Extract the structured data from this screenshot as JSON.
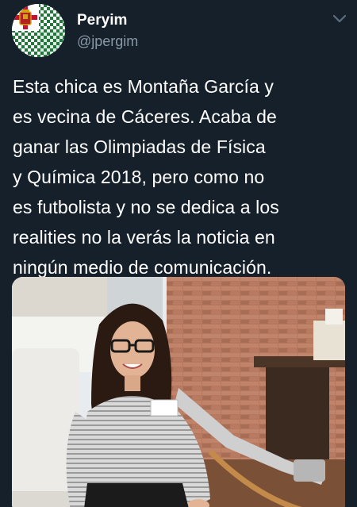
{
  "tweet": {
    "author": {
      "display_name": "Peryim",
      "handle": "@jpergim",
      "avatar_icon": "flag-avatar-icon"
    },
    "menu_icon": "chevron-down-icon",
    "text": "Esta chica es Montaña García y\nes vecina de Cáceres. Acaba de\nganar las Olimpiadas de Física\ny Química 2018, pero como no\nes futbolista y no se dedica a los\nrealities no la verás la noticia en\nningún medio de comunicación.",
    "media": {
      "type": "photo"
    }
  },
  "colors": {
    "background": "#16202b",
    "text_primary": "#ffffff",
    "text_secondary": "#8899a6"
  }
}
